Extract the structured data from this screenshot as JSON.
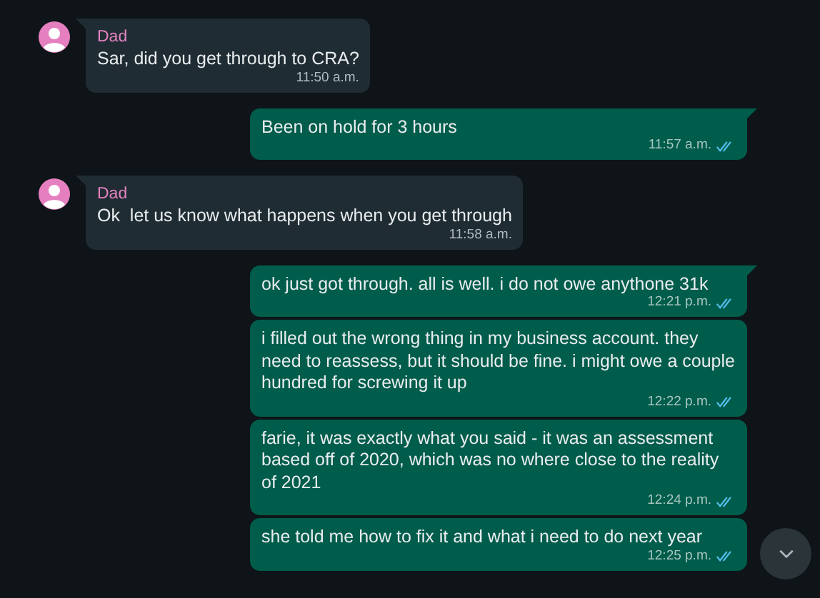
{
  "groups": [
    {
      "kind": "incoming",
      "sender": "Dad",
      "messages": [
        {
          "text": "Sar, did you get through to CRA?",
          "time": "11:50 a.m."
        }
      ]
    },
    {
      "kind": "outgoing",
      "messages": [
        {
          "text": "Been on hold for 3 hours",
          "time": "11:57 a.m.",
          "read": true
        }
      ]
    },
    {
      "kind": "incoming",
      "sender": "Dad",
      "messages": [
        {
          "text": "Ok  let us know what happens when you get through",
          "time": "11:58 a.m."
        }
      ]
    },
    {
      "kind": "outgoing",
      "messages": [
        {
          "text": "ok just got through. all is well. i do not owe anythone 31k",
          "time": "12:21 p.m.",
          "read": true
        },
        {
          "text": "i filled out the wrong thing in my business account. they need to reassess, but it should be fine. i might owe a couple hundred for screwing it up",
          "time": "12:22 p.m.",
          "read": true
        },
        {
          "text": "farie, it was exactly what you said - it was an assessment based off of 2020, which was no where close to the reality of 2021",
          "time": "12:24 p.m.",
          "read": true
        },
        {
          "text": "she told me how to fix it and what i need to do next year",
          "time": "12:25 p.m.",
          "read": true
        }
      ]
    }
  ]
}
